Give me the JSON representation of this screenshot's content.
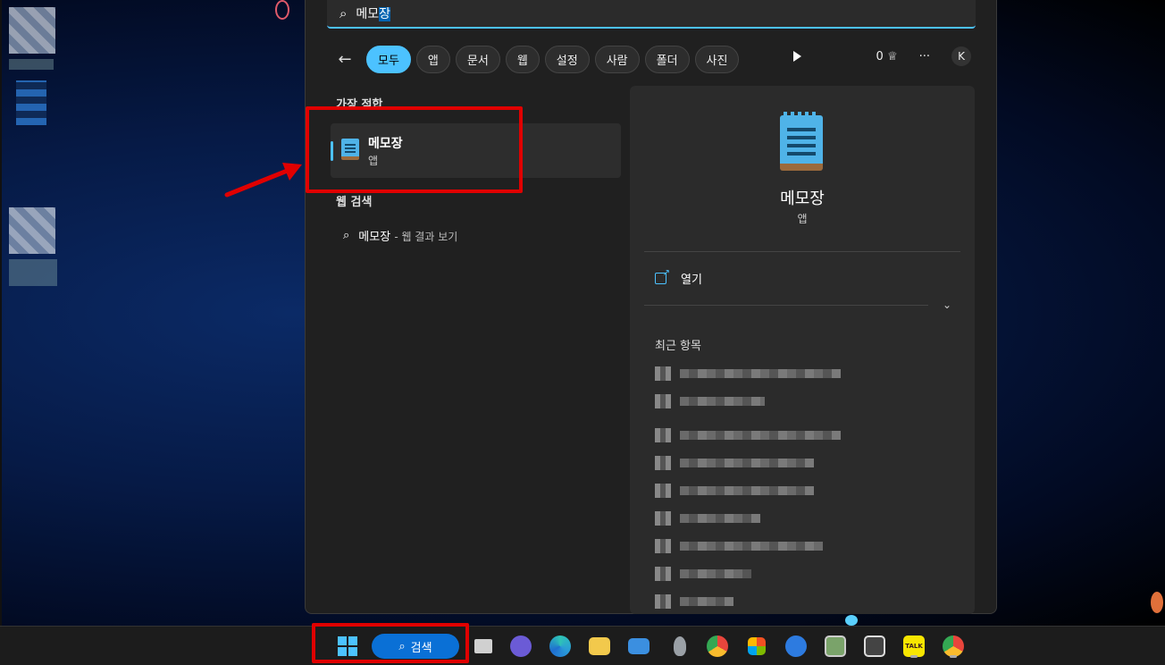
{
  "search": {
    "query_prefix": "메모",
    "query_selected": "장",
    "search_icon": "search-icon"
  },
  "filters": {
    "back_icon": "back-arrow-icon",
    "items": [
      {
        "label": "모두",
        "active": true
      },
      {
        "label": "앱",
        "active": false
      },
      {
        "label": "문서",
        "active": false
      },
      {
        "label": "웹",
        "active": false
      },
      {
        "label": "설정",
        "active": false
      },
      {
        "label": "사람",
        "active": false
      },
      {
        "label": "폴더",
        "active": false
      },
      {
        "label": "사진",
        "active": false
      }
    ],
    "rewards_count": "0",
    "more_label": "···",
    "account_initial": "K"
  },
  "results": {
    "best_match_label": "가장 적합",
    "best_match": {
      "title": "메모장",
      "subtitle": "앱"
    },
    "web_search_label": "웹 검색",
    "web_result": {
      "query": "메모장",
      "suffix": "- 웹 결과 보기"
    }
  },
  "detail": {
    "title": "메모장",
    "subtitle": "앱",
    "open_label": "열기",
    "recent_label": "최근 항목"
  },
  "taskbar": {
    "search_label": "검색",
    "apps": [
      {
        "name": "task-view-icon",
        "color": "#d0d0d0"
      },
      {
        "name": "teams-icon",
        "color": "#6b5bd6"
      },
      {
        "name": "edge-icon",
        "color": "#2a9bd8"
      },
      {
        "name": "file-explorer-icon",
        "color": "#f2c94c"
      },
      {
        "name": "mail-icon",
        "color": "#3b8fe0"
      },
      {
        "name": "alienware-icon",
        "color": "#9aa0a6"
      },
      {
        "name": "chrome-icon",
        "color": "#e8453c"
      },
      {
        "name": "store-icon",
        "color": "#5aa0e6"
      },
      {
        "name": "update-icon",
        "color": "#2d7be0"
      },
      {
        "name": "image-viewer-icon",
        "color": "#7aa36a"
      },
      {
        "name": "remote-desktop-icon",
        "color": "#444"
      },
      {
        "name": "kakaotalk-icon",
        "color": "#f7e600",
        "label": "TALK"
      },
      {
        "name": "chrome-profile-icon",
        "color": "#e8453c"
      }
    ]
  },
  "colors": {
    "accent": "#4cc2ff",
    "annotation": "#e00000"
  }
}
